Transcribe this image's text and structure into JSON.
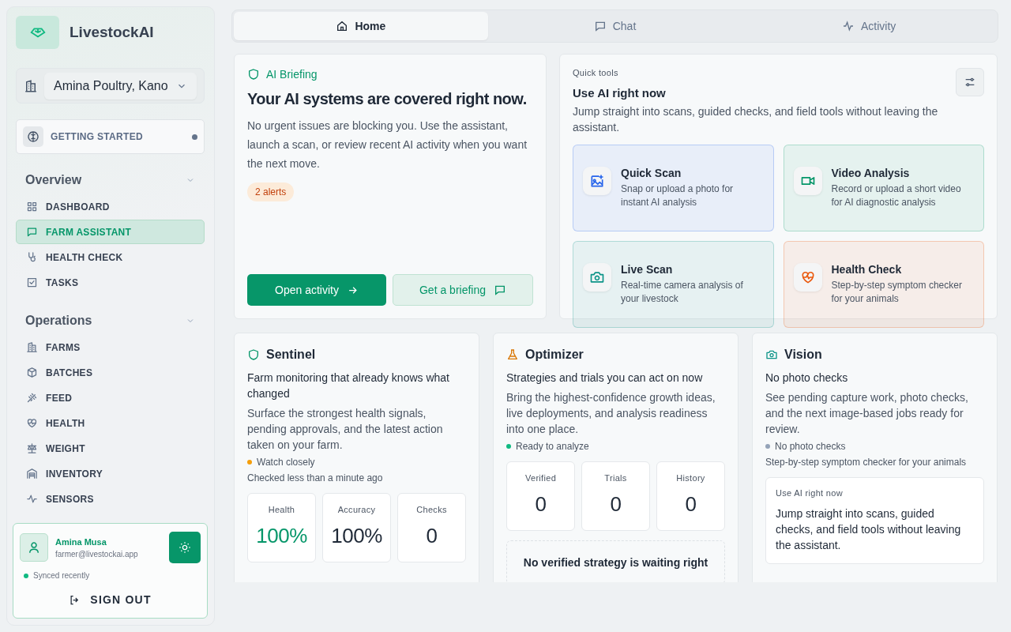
{
  "brand": "LivestockAI",
  "farm_select": {
    "value": "Amina Poultry, Kano"
  },
  "getting_started": {
    "label": "GETTING STARTED",
    "unread": true
  },
  "nav_sections": [
    {
      "title": "Overview",
      "expanded": true,
      "items": [
        {
          "label": "DASHBOARD",
          "selected": false
        },
        {
          "label": "FARM ASSISTANT",
          "selected": true
        },
        {
          "label": "HEALTH CHECK",
          "selected": false
        },
        {
          "label": "TASKS",
          "selected": false
        }
      ]
    },
    {
      "title": "Operations",
      "expanded": true,
      "items": [
        {
          "label": "FARMS",
          "selected": false
        },
        {
          "label": "BATCHES",
          "selected": false
        },
        {
          "label": "FEED",
          "selected": false
        },
        {
          "label": "HEALTH",
          "selected": false
        },
        {
          "label": "WEIGHT",
          "selected": false
        },
        {
          "label": "INVENTORY",
          "selected": false
        },
        {
          "label": "SENSORS",
          "selected": false
        }
      ]
    }
  ],
  "user": {
    "name": "Amina Musa",
    "email": "farmer@livestockai.app",
    "status": "Synced recently",
    "sign_out": "SIGN OUT"
  },
  "tabs": [
    {
      "label": "Home",
      "selected": true
    },
    {
      "label": "Chat",
      "selected": false
    },
    {
      "label": "Activity",
      "selected": false
    }
  ],
  "briefing": {
    "kicker": "AI Briefing",
    "title": "Your AI systems are covered right now.",
    "body": "No urgent issues are blocking you. Use the assistant, launch a scan, or review recent AI activity when you want the next move.",
    "badge": "2 alerts",
    "primary_button": "Open activity",
    "secondary_button": "Get a briefing"
  },
  "quick_tools": {
    "kicker": "Quick tools",
    "title": "Use AI right now",
    "body": "Jump straight into scans, guided checks, and field tools without leaving the assistant.",
    "tools": [
      {
        "title": "Quick Scan",
        "description": "Snap or upload a photo for instant AI analysis",
        "color": "#2563eb"
      },
      {
        "title": "Video Analysis",
        "description": "Record or upload a short video for AI diagnostic analysis",
        "color": "#059669"
      },
      {
        "title": "Live Scan",
        "description": "Real-time camera analysis of your livestock",
        "color": "#0d9488"
      },
      {
        "title": "Health Check",
        "description": "Step-by-step symptom checker for your animals",
        "color": "#ea580c"
      }
    ]
  },
  "cards": [
    {
      "kind": "sentinel",
      "title": "Sentinel",
      "subtitle": "Farm monitoring that already knows what changed",
      "body": "Surface the strongest health signals, pending approvals, and the latest action taken on your farm.",
      "status": {
        "text": "Watch closely",
        "color": "#f59e0b"
      },
      "note": "Checked less than a minute ago",
      "stats": [
        {
          "label": "Health",
          "value": "100%",
          "highlight": true
        },
        {
          "label": "Accuracy",
          "value": "100%",
          "highlight": false
        },
        {
          "label": "Checks",
          "value": "0",
          "highlight": false
        }
      ]
    },
    {
      "kind": "optimizer",
      "title": "Optimizer",
      "subtitle": "Strategies and trials you can act on now",
      "body": "Bring the highest-confidence growth ideas, live deployments, and analysis readiness into one place.",
      "status": {
        "text": "Ready to analyze",
        "color": "#10b981"
      },
      "stats": [
        {
          "label": "Verified",
          "value": "0",
          "highlight": false
        },
        {
          "label": "Trials",
          "value": "0",
          "highlight": false
        },
        {
          "label": "History",
          "value": "0",
          "highlight": false
        }
      ],
      "empty_note": "No verified strategy is waiting right"
    },
    {
      "kind": "vision",
      "title": "Vision",
      "subtitle": "No photo checks",
      "body": "See pending capture work, photo checks, and the next image-based jobs ready for review.",
      "status": {
        "text": "No photo checks",
        "color": "#94a3b8"
      },
      "note": "Step-by-step symptom checker for your animals",
      "inner": {
        "kicker": "Use AI right now",
        "body": "Jump straight into scans, guided checks, and field tools without leaving the assistant."
      }
    }
  ]
}
